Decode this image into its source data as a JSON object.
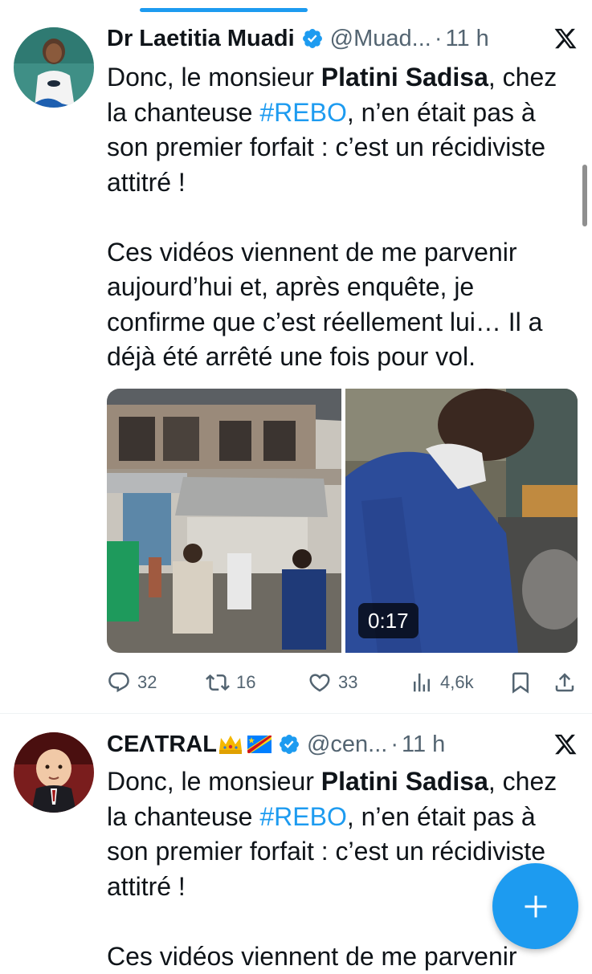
{
  "tweets": [
    {
      "display_name": "Dr Laetitia Muadi",
      "handle": "@Muad...",
      "time": "11 h",
      "body": {
        "p1_a": "Donc, le monsieur ",
        "p1_mention": "Platini Sadisa",
        "p1_b": ", chez la chanteuse ",
        "p1_hashtag": "#REBO",
        "p1_c": ", n’en était pas à son premier forfait : c’est un récidiviste attitré !",
        "p2": "Ces vidéos viennent de me parvenir aujourd’hui et, après enquête, je confirme que c’est réellement lui… Il a déjà été arrêté une fois pour vol."
      },
      "video_duration": "0:17",
      "stats": {
        "replies": "32",
        "retweets": "16",
        "likes": "33",
        "views": "4,6k"
      }
    },
    {
      "display_name": "CEɅTRAL",
      "handle": "@cen...",
      "time": "11 h",
      "body": {
        "p1_a": "Donc, le monsieur ",
        "p1_mention": "Platini Sadisa",
        "p1_b": ", chez la chanteuse ",
        "p1_hashtag": "#REBO",
        "p1_c": ", n’en était pas à son premier forfait : c’est un récidiviste attitré !",
        "p2": "Ces vidéos viennent de me parvenir"
      }
    }
  ],
  "separator_dot": "·",
  "icons": {
    "verified": "verified-badge-icon",
    "platform": "x-logo-icon",
    "reply": "reply-icon",
    "retweet": "retweet-icon",
    "like": "heart-icon",
    "views": "views-icon",
    "bookmark": "bookmark-icon",
    "share": "share-icon",
    "compose": "plus-icon"
  },
  "colors": {
    "accent": "#1d9bf0",
    "text": "#0f1419",
    "secondary": "#536471"
  }
}
